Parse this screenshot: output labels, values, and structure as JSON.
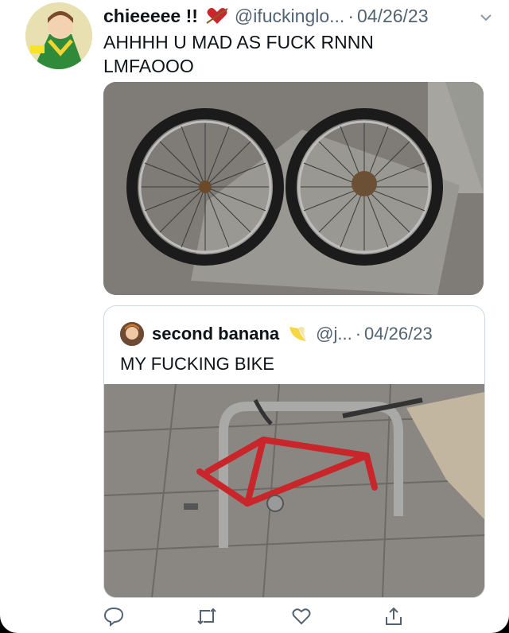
{
  "tweet": {
    "display_name": "chieeeee !!",
    "name_emoji": "heart-arrow-emoji",
    "handle": "@ifuckinglo...",
    "separator": "·",
    "date": "04/26/23",
    "text_line1": "AHHHH U MAD AS FUCK RNNN",
    "text_line2": "LMFAOOO",
    "media_description": "two bicycle wheels lying on the pavement"
  },
  "quote": {
    "display_name": "second banana",
    "name_emoji": "banana-emoji",
    "handle": "@j...",
    "separator": "·",
    "date": "04/26/23",
    "text": "MY FUCKING BIKE",
    "media_description": "red bicycle frame locked to a bike rack without wheels"
  },
  "actions": [
    "reply-icon",
    "retweet-icon",
    "like-icon",
    "share-icon"
  ],
  "colors": {
    "text": "#0f1419",
    "secondary": "#536471",
    "border": "#cfd9de"
  }
}
